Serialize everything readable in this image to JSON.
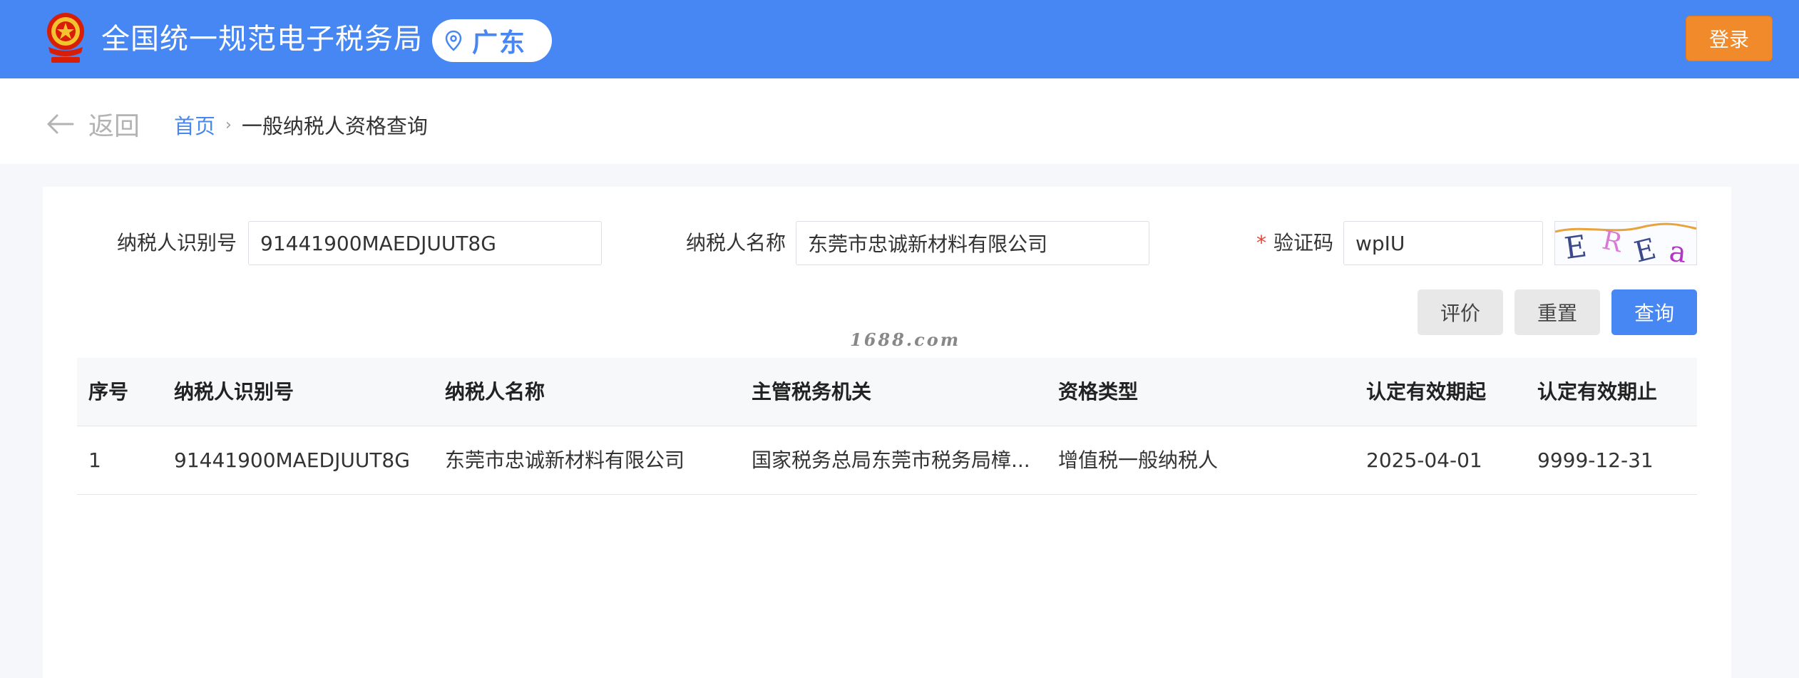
{
  "header": {
    "site_title": "全国统一规范电子税务局",
    "region": "广东",
    "login_label": "登录"
  },
  "nav": {
    "back_label": "返回",
    "breadcrumb_home": "首页",
    "breadcrumb_current": "一般纳税人资格查询"
  },
  "form": {
    "taxpayer_id_label": "纳税人识别号",
    "taxpayer_id_value": "91441900MAEDJUUT8G",
    "taxpayer_name_label": "纳税人名称",
    "taxpayer_name_value": "东莞市忠诚新材料有限公司",
    "captcha_required_mark": "*",
    "captcha_label": "验证码",
    "captcha_value": "wpIU",
    "captcha_image_text": "EREa"
  },
  "buttons": {
    "rate": "评价",
    "reset": "重置",
    "query": "查询"
  },
  "watermark": "1688.com",
  "table": {
    "columns": [
      "序号",
      "纳税人识别号",
      "纳税人名称",
      "主管税务机关",
      "资格类型",
      "认定有效期起",
      "认定有效期止"
    ],
    "rows": [
      [
        "1",
        "91441900MAEDJUUT8G",
        "东莞市忠诚新材料有限公司",
        "国家税务总局东莞市税务局樟...",
        "增值税一般纳税人",
        "2025-04-01",
        "9999-12-31"
      ]
    ]
  },
  "colors": {
    "header_bg": "#4787f3",
    "login_bg": "#f08a2b",
    "accent": "#4787f3"
  }
}
